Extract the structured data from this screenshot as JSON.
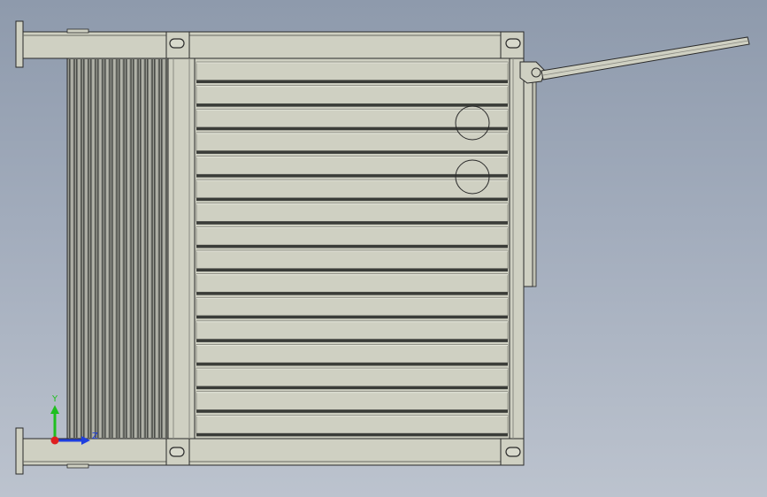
{
  "viewport": {
    "background_top": "#8e9aac",
    "background_bottom": "#bcc3ce"
  },
  "model": {
    "part_color": "#cfd0c2",
    "part_shade": "#bfc0b2",
    "edge_color": "#2a2a2a",
    "slot_dark": "#3a3c38",
    "fin_dark": "#4a4c48",
    "fin_light": "#9a9c94",
    "louver_count": 16,
    "fin_count": 42,
    "round_features": 2
  },
  "triad": {
    "y_label": "Y",
    "z_label": "Z",
    "y_color": "#1fbf1f",
    "z_color": "#1f3fdf",
    "x_color": "#df1f1f"
  }
}
